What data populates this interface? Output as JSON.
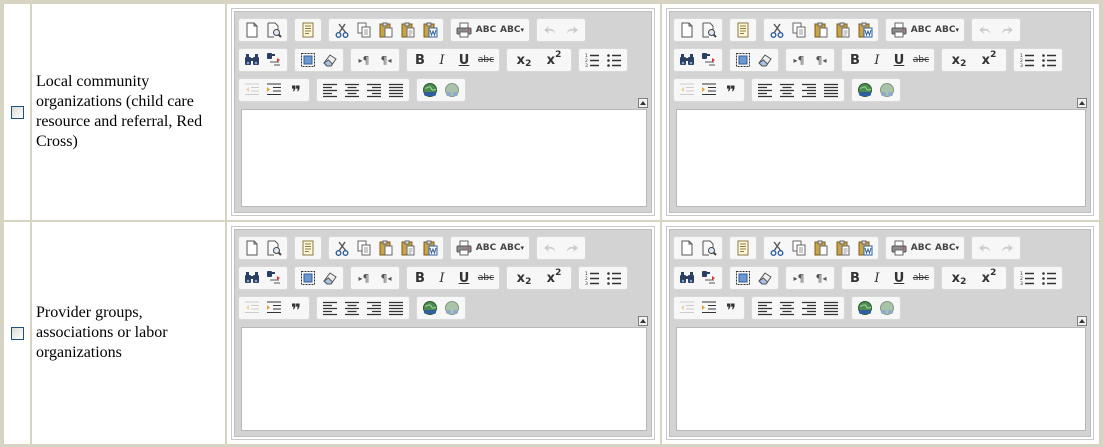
{
  "rows": [
    {
      "label": "Local community organizations (child care resource and referral, Red Cross)"
    },
    {
      "label": "Provider groups, associations or labor organizations"
    }
  ],
  "editor": {
    "content": "",
    "toolbar": {
      "line1": [
        [
          "new-page-icon",
          "preview-icon"
        ],
        [
          "templates-icon"
        ],
        [
          "cut-icon",
          "copy-icon",
          "paste-icon",
          "paste-text-icon",
          "paste-word-icon"
        ],
        [
          "print-icon",
          "spellcheck-icon",
          "scayt-icon"
        ],
        [
          "undo-icon",
          "redo-icon"
        ]
      ],
      "line2": [
        [
          "find-icon",
          "replace-icon"
        ],
        [
          "select-all-icon",
          "remove-format-icon"
        ],
        [
          "ltr-icon",
          "rtl-icon"
        ],
        [
          "bold-icon",
          "italic-icon",
          "underline-icon",
          "strike-icon"
        ],
        [
          "subscript-icon",
          "superscript-icon"
        ],
        [
          "numbered-list-icon",
          "bulleted-list-icon"
        ]
      ],
      "line3": [
        [
          "outdent-icon",
          "indent-icon",
          "blockquote-icon"
        ],
        [
          "align-left-icon",
          "align-center-icon",
          "align-right-icon",
          "justify-icon"
        ],
        [
          "link-icon",
          "unlink-icon"
        ]
      ],
      "glyphs": {
        "bold": "B",
        "italic": "I",
        "underline": "U",
        "strike": "abc",
        "spell": "ABC",
        "quote": "❞"
      }
    }
  }
}
